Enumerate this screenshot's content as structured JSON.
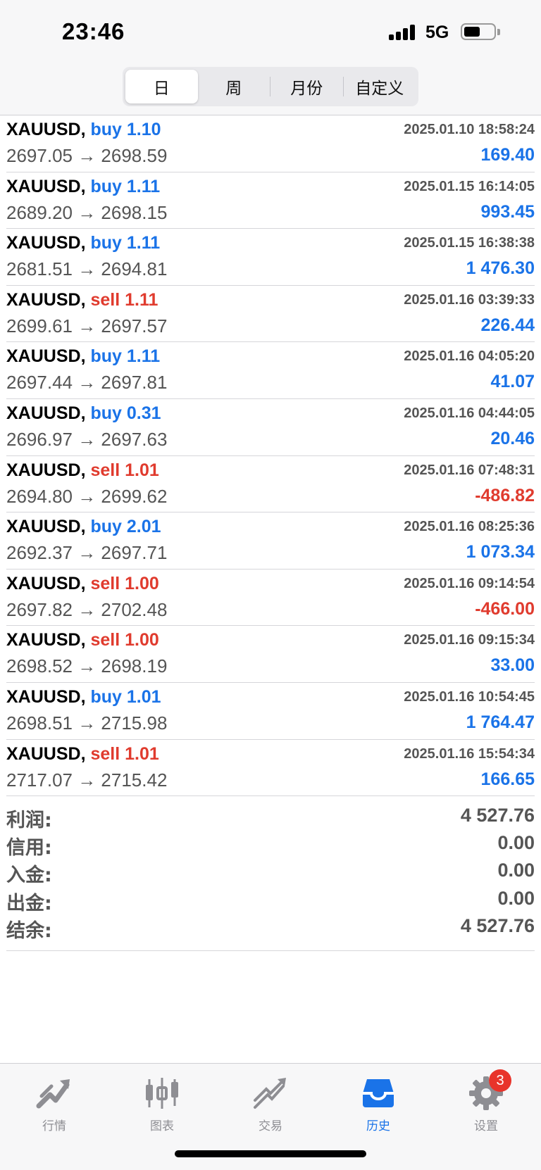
{
  "status": {
    "time": "23:46",
    "network": "5G"
  },
  "periods": [
    {
      "label": "日",
      "active": true
    },
    {
      "label": "周",
      "active": false
    },
    {
      "label": "月份",
      "active": false
    },
    {
      "label": "自定义",
      "active": false
    }
  ],
  "deals": [
    {
      "symbol": "XAUUSD,",
      "direction": "buy",
      "lots": "1.10",
      "time": "2025.01.10 18:58:24",
      "prices": "2697.05 → 2698.59",
      "profit": "169.40",
      "sign": "pos"
    },
    {
      "symbol": "XAUUSD,",
      "direction": "buy",
      "lots": "1.11",
      "time": "2025.01.15 16:14:05",
      "prices": "2689.20 → 2698.15",
      "profit": "993.45",
      "sign": "pos"
    },
    {
      "symbol": "XAUUSD,",
      "direction": "buy",
      "lots": "1.11",
      "time": "2025.01.15 16:38:38",
      "prices": "2681.51 → 2694.81",
      "profit": "1 476.30",
      "sign": "pos"
    },
    {
      "symbol": "XAUUSD,",
      "direction": "sell",
      "lots": "1.11",
      "time": "2025.01.16 03:39:33",
      "prices": "2699.61 → 2697.57",
      "profit": "226.44",
      "sign": "pos"
    },
    {
      "symbol": "XAUUSD,",
      "direction": "buy",
      "lots": "1.11",
      "time": "2025.01.16 04:05:20",
      "prices": "2697.44 → 2697.81",
      "profit": "41.07",
      "sign": "pos"
    },
    {
      "symbol": "XAUUSD,",
      "direction": "buy",
      "lots": "0.31",
      "time": "2025.01.16 04:44:05",
      "prices": "2696.97 → 2697.63",
      "profit": "20.46",
      "sign": "pos"
    },
    {
      "symbol": "XAUUSD,",
      "direction": "sell",
      "lots": "1.01",
      "time": "2025.01.16 07:48:31",
      "prices": "2694.80 → 2699.62",
      "profit": "-486.82",
      "sign": "neg"
    },
    {
      "symbol": "XAUUSD,",
      "direction": "buy",
      "lots": "2.01",
      "time": "2025.01.16 08:25:36",
      "prices": "2692.37 → 2697.71",
      "profit": "1 073.34",
      "sign": "pos"
    },
    {
      "symbol": "XAUUSD,",
      "direction": "sell",
      "lots": "1.00",
      "time": "2025.01.16 09:14:54",
      "prices": "2697.82 → 2702.48",
      "profit": "-466.00",
      "sign": "neg"
    },
    {
      "symbol": "XAUUSD,",
      "direction": "sell",
      "lots": "1.00",
      "time": "2025.01.16 09:15:34",
      "prices": "2698.52 → 2698.19",
      "profit": "33.00",
      "sign": "pos"
    },
    {
      "symbol": "XAUUSD,",
      "direction": "buy",
      "lots": "1.01",
      "time": "2025.01.16 10:54:45",
      "prices": "2698.51 → 2715.98",
      "profit": "1 764.47",
      "sign": "pos"
    },
    {
      "symbol": "XAUUSD,",
      "direction": "sell",
      "lots": "1.01",
      "time": "2025.01.16 15:54:34",
      "prices": "2717.07 → 2715.42",
      "profit": "166.65",
      "sign": "pos"
    }
  ],
  "summary": [
    {
      "label": "利润:",
      "value": "4 527.76"
    },
    {
      "label": "信用:",
      "value": "0.00"
    },
    {
      "label": "入金:",
      "value": "0.00"
    },
    {
      "label": "出金:",
      "value": "0.00"
    },
    {
      "label": "结余:",
      "value": "4 527.76"
    }
  ],
  "tabs": [
    {
      "label": "行情",
      "icon": "quotes-icon",
      "active": false
    },
    {
      "label": "图表",
      "icon": "chart-candles-icon",
      "active": false
    },
    {
      "label": "交易",
      "icon": "trade-icon",
      "active": false
    },
    {
      "label": "历史",
      "icon": "history-inbox-icon",
      "active": true
    },
    {
      "label": "设置",
      "icon": "gear-icon",
      "active": false,
      "badge": "3"
    }
  ],
  "colors": {
    "buy": "#1a73e8",
    "sell": "#e03b2e",
    "active_tab": "#1a73e8",
    "inactive_tab": "#8e8e93",
    "badge": "#e8342b"
  }
}
